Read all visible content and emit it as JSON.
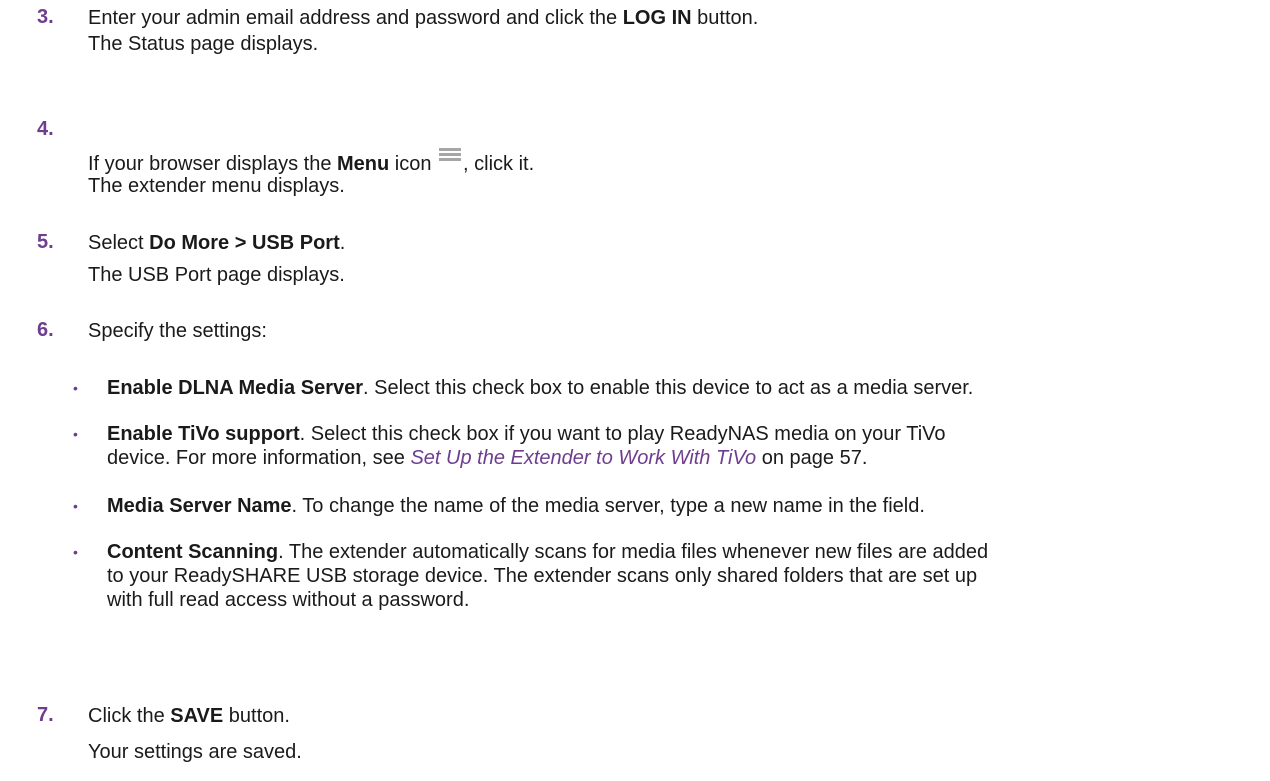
{
  "steps": [
    {
      "number": "3.",
      "line1_pre": "Enter your admin email address and password and click the ",
      "line1_bold": "LOG IN",
      "line1_post": " button.",
      "line2": "The Status page displays."
    },
    {
      "number": "4.",
      "line1_pre": "If your browser displays the ",
      "line1_bold": "Menu",
      "line1_mid": " icon ",
      "line1_post": ", click it.",
      "icon": "menu-icon",
      "line2": "The extender menu displays."
    },
    {
      "number": "5.",
      "line1_pre": "Select ",
      "line1_bold": "Do More > USB Port",
      "line1_post": ".",
      "line2": "The USB Port page displays."
    },
    {
      "number": "6.",
      "line1": "Specify the settings:"
    },
    {
      "number": "7.",
      "line1_pre": "Click the ",
      "line1_bold": "SAVE",
      "line1_post": " button.",
      "line2": "Your settings are saved."
    }
  ],
  "bullets": [
    {
      "bold": "Enable DLNA Media Server",
      "text": ". Select this check box to enable this device to act as a media server."
    },
    {
      "bold": "Enable TiVo support",
      "text_a": ". Select this check box if you want to play ReadyNAS media on your TiVo",
      "text_b": "device. For more information, see ",
      "link": "Set Up the Extender to Work With TiVo",
      "text_c": " on page 57."
    },
    {
      "bold": "Media Server Name",
      "text": ". To change the name of the media server, type a new name in the field."
    },
    {
      "bold": "Content Scanning",
      "text_a": ". The extender automatically scans for media files whenever new files are added",
      "text_b": "to your ReadySHARE USB storage device. The extender scans only shared folders that are set up",
      "text_c": "with full read access without a password."
    }
  ],
  "bullet_char": "•"
}
